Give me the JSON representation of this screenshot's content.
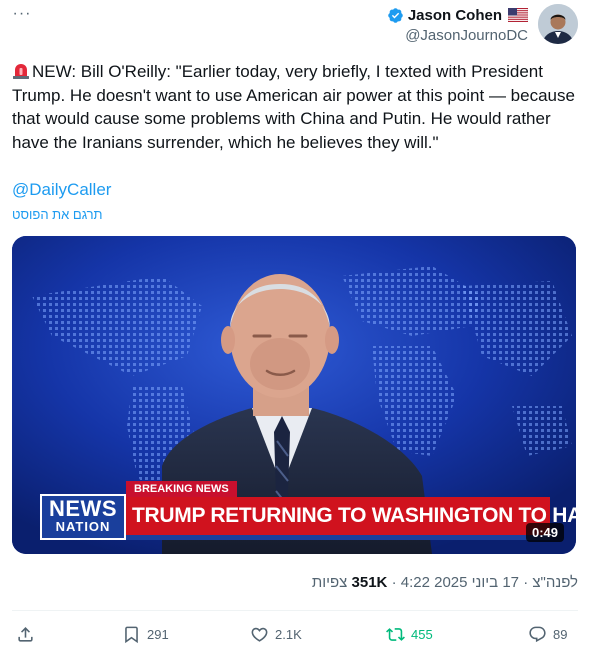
{
  "header": {
    "display_name": "Jason Cohen",
    "handle": "@JasonJournoDC",
    "more_label": "···"
  },
  "tweet": {
    "text": "NEW: Bill O'Reilly: \"Earlier today, very briefly, I texted with President Trump. He doesn't want to use American air power at this point — because that would cause some problems with China and Putin. He would rather have the Iranians surrender, which he believes they will.\"",
    "mention": "@DailyCaller",
    "translate_label": "תרגם את הפוסט"
  },
  "media": {
    "breaking_label": "BREAKING NEWS",
    "headline": "TRUMP RETURNING TO WASHINGTON TO HANDLE IRAN",
    "logo_top": "NEWS",
    "logo_bottom": "NATION",
    "duration": "0:49"
  },
  "meta": {
    "time": "4:22",
    "date": "17 ביוני 2025",
    "period": "לפנה\"צ",
    "views_count": "351K",
    "views_label": "צפיות",
    "separator": "·"
  },
  "actions": {
    "reply_count": "89",
    "retweet_count": "455",
    "like_count": "2.1K",
    "bookmark_count": "291"
  },
  "colors": {
    "accent": "#1d9bf0",
    "retweet": "#00ba7c",
    "muted": "#536471",
    "breaking_red": "#d0121e",
    "newsnation_blue": "#1a3f9c"
  }
}
